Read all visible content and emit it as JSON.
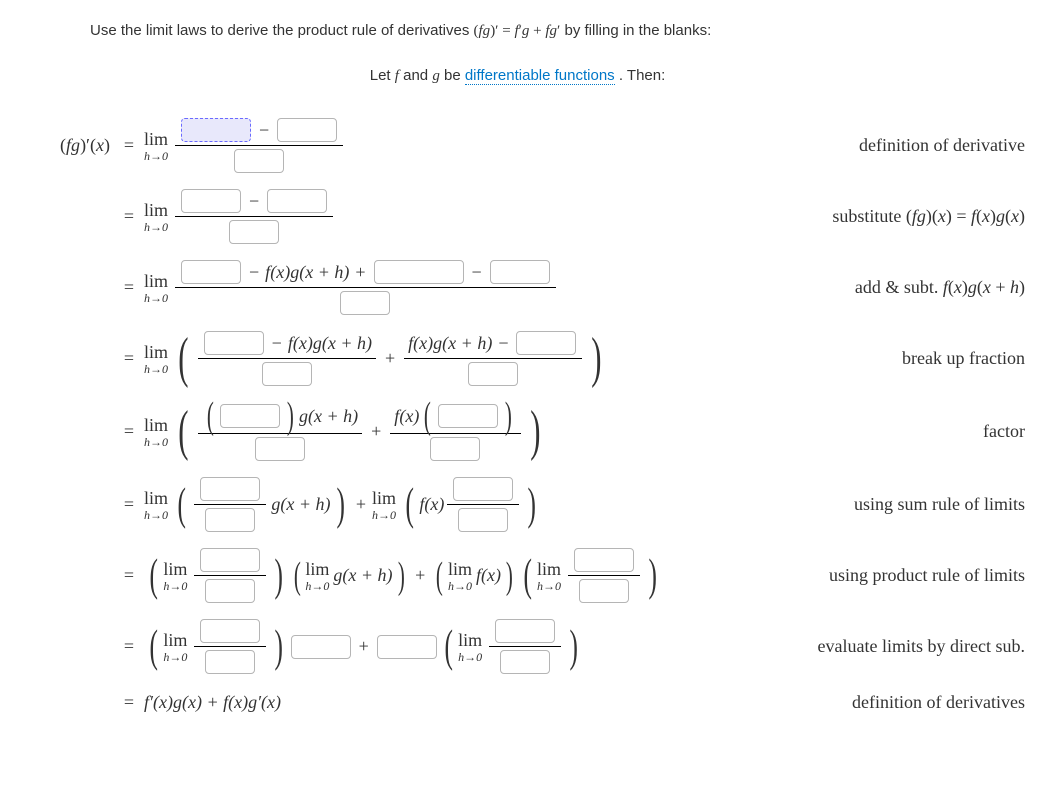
{
  "instructions_prefix": "Use the limit laws to derive the product rule of derivatives ",
  "instructions_math": "(fg)′ = f′g + fg′",
  "instructions_suffix": " by filling in the blanks:",
  "intro_prefix": "Let ",
  "intro_f": "f",
  "intro_and": " and ",
  "intro_g": "g",
  "intro_be": " be ",
  "intro_link": "differentiable functions",
  "intro_then": ". Then:",
  "lhs": "(fg)′(x)",
  "eq": "=",
  "lim_top": "lim",
  "lim_bot": "h→0",
  "minus": "−",
  "plus": "+",
  "step1_reason": "definition of derivative",
  "step2_reason": "substitute (fg)(x) = f(x)g(x)",
  "step3_mid": "f(x)g(x + h)",
  "step3_reason": "add & subt. f(x)g(x + h)",
  "step4_a": "f(x)g(x + h)",
  "step4_b": "f(x)g(x + h)",
  "step4_reason": "break up fraction",
  "step5_gxh": "g(x + h)",
  "step5_fx": "f(x)",
  "step5_reason": "factor",
  "step6_gxh": "g(x + h)",
  "step6_fx": "f(x)",
  "step6_reason": "using sum rule of limits",
  "step7_gxh": "g(x + h)",
  "step7_fx": "f(x)",
  "step7_reason": "using product rule of limits",
  "step8_reason": "evaluate limits by direct sub.",
  "final": "f′(x)g(x) + f(x)g′(x)",
  "final_reason": "definition of derivatives"
}
